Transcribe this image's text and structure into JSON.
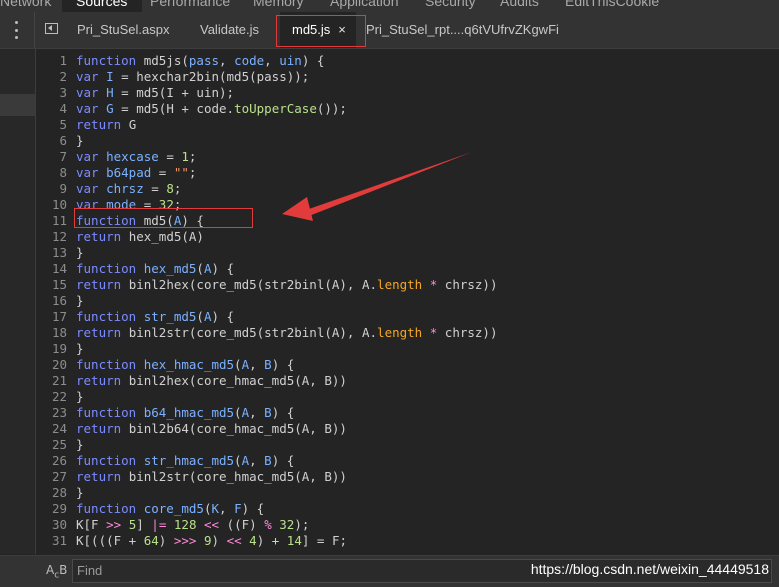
{
  "top_tabs": [
    "Network",
    "Sources",
    "Performance",
    "Memory",
    "Application",
    "Security",
    "Audits",
    "EditThisCookie"
  ],
  "file_tabs": [
    {
      "label": "Pri_StuSel.aspx"
    },
    {
      "label": "Validate.js"
    },
    {
      "label": "md5.js",
      "close": "×"
    },
    {
      "label": "Pri_StuSel_rpt....q6tVUfrvZKgwFi"
    }
  ],
  "icons": {
    "more": "kebab-icon",
    "navigator": "toggle-navigator-icon",
    "close": "close-icon",
    "match_case": "match-case-icon"
  },
  "colors": {
    "keyword": "#7b8cff",
    "variable": "#7bb1ff",
    "number": "#b9e08a",
    "string": "#f29766",
    "annotation": "#e23b3b"
  },
  "code_lines": [
    {
      "n": "1",
      "t": [
        [
          "k",
          "function "
        ],
        [
          "p",
          "md5js("
        ],
        [
          "v",
          "pass"
        ],
        [
          "p",
          ", "
        ],
        [
          "v",
          "code"
        ],
        [
          "p",
          ", "
        ],
        [
          "v",
          "uin"
        ],
        [
          "p",
          ") {"
        ]
      ]
    },
    {
      "n": "2",
      "t": [
        [
          "k",
          "var "
        ],
        [
          "v",
          "I"
        ],
        [
          "p",
          " = hexchar2bin(md5(pass));"
        ]
      ]
    },
    {
      "n": "3",
      "t": [
        [
          "k",
          "var "
        ],
        [
          "v",
          "H"
        ],
        [
          "p",
          " = md5(I + uin);"
        ]
      ]
    },
    {
      "n": "4",
      "t": [
        [
          "k",
          "var "
        ],
        [
          "v",
          "G"
        ],
        [
          "p",
          " = md5(H + code."
        ],
        [
          "n",
          "toUpperCase"
        ],
        [
          "p",
          "());"
        ]
      ]
    },
    {
      "n": "5",
      "t": [
        [
          "k",
          "return "
        ],
        [
          "p",
          "G"
        ]
      ]
    },
    {
      "n": "6",
      "t": [
        [
          "p",
          "}"
        ]
      ]
    },
    {
      "n": "7",
      "t": [
        [
          "k",
          "var "
        ],
        [
          "v",
          "hexcase"
        ],
        [
          "p",
          " = "
        ],
        [
          "n",
          "1"
        ],
        [
          "p",
          ";"
        ]
      ]
    },
    {
      "n": "8",
      "t": [
        [
          "k",
          "var "
        ],
        [
          "v",
          "b64pad"
        ],
        [
          "p",
          " = "
        ],
        [
          "s",
          "\"\""
        ],
        [
          "p",
          ";"
        ]
      ]
    },
    {
      "n": "9",
      "t": [
        [
          "k",
          "var "
        ],
        [
          "v",
          "chrsz"
        ],
        [
          "p",
          " = "
        ],
        [
          "n",
          "8"
        ],
        [
          "p",
          ";"
        ]
      ]
    },
    {
      "n": "10",
      "t": [
        [
          "k",
          "var "
        ],
        [
          "v",
          "mode"
        ],
        [
          "p",
          " = "
        ],
        [
          "n",
          "32"
        ],
        [
          "p",
          ";"
        ]
      ]
    },
    {
      "n": "11",
      "t": [
        [
          "k",
          "function "
        ],
        [
          "p",
          "md5("
        ],
        [
          "v",
          "A"
        ],
        [
          "p",
          ") {"
        ]
      ]
    },
    {
      "n": "12",
      "t": [
        [
          "k",
          "return "
        ],
        [
          "p",
          "hex_md5(A)"
        ]
      ]
    },
    {
      "n": "13",
      "t": [
        [
          "p",
          "}"
        ]
      ]
    },
    {
      "n": "14",
      "t": [
        [
          "k",
          "function "
        ],
        [
          "v",
          "hex_md5"
        ],
        [
          "p",
          "("
        ],
        [
          "v",
          "A"
        ],
        [
          "p",
          ") {"
        ]
      ]
    },
    {
      "n": "15",
      "t": [
        [
          "k",
          "return "
        ],
        [
          "p",
          "binl2hex(core_md5(str2binl(A), A."
        ],
        [
          "m",
          "length"
        ],
        [
          "p",
          " "
        ],
        [
          "o",
          "*"
        ],
        [
          "p",
          " chrsz))"
        ]
      ]
    },
    {
      "n": "16",
      "t": [
        [
          "p",
          "}"
        ]
      ]
    },
    {
      "n": "17",
      "t": [
        [
          "k",
          "function "
        ],
        [
          "v",
          "str_md5"
        ],
        [
          "p",
          "("
        ],
        [
          "v",
          "A"
        ],
        [
          "p",
          ") {"
        ]
      ]
    },
    {
      "n": "18",
      "t": [
        [
          "k",
          "return "
        ],
        [
          "p",
          "binl2str(core_md5(str2binl(A), A."
        ],
        [
          "m",
          "length"
        ],
        [
          "p",
          " "
        ],
        [
          "o",
          "*"
        ],
        [
          "p",
          " chrsz))"
        ]
      ]
    },
    {
      "n": "19",
      "t": [
        [
          "p",
          "}"
        ]
      ]
    },
    {
      "n": "20",
      "t": [
        [
          "k",
          "function "
        ],
        [
          "v",
          "hex_hmac_md5"
        ],
        [
          "p",
          "("
        ],
        [
          "v",
          "A"
        ],
        [
          "p",
          ", "
        ],
        [
          "v",
          "B"
        ],
        [
          "p",
          ") {"
        ]
      ]
    },
    {
      "n": "21",
      "t": [
        [
          "k",
          "return "
        ],
        [
          "p",
          "binl2hex(core_hmac_md5(A, B))"
        ]
      ]
    },
    {
      "n": "22",
      "t": [
        [
          "p",
          "}"
        ]
      ]
    },
    {
      "n": "23",
      "t": [
        [
          "k",
          "function "
        ],
        [
          "v",
          "b64_hmac_md5"
        ],
        [
          "p",
          "("
        ],
        [
          "v",
          "A"
        ],
        [
          "p",
          ", "
        ],
        [
          "v",
          "B"
        ],
        [
          "p",
          ") {"
        ]
      ]
    },
    {
      "n": "24",
      "t": [
        [
          "k",
          "return "
        ],
        [
          "p",
          "binl2b64(core_hmac_md5(A, B))"
        ]
      ]
    },
    {
      "n": "25",
      "t": [
        [
          "p",
          "}"
        ]
      ]
    },
    {
      "n": "26",
      "t": [
        [
          "k",
          "function "
        ],
        [
          "v",
          "str_hmac_md5"
        ],
        [
          "p",
          "("
        ],
        [
          "v",
          "A"
        ],
        [
          "p",
          ", "
        ],
        [
          "v",
          "B"
        ],
        [
          "p",
          ") {"
        ]
      ]
    },
    {
      "n": "27",
      "t": [
        [
          "k",
          "return "
        ],
        [
          "p",
          "binl2str(core_hmac_md5(A, B))"
        ]
      ]
    },
    {
      "n": "28",
      "t": [
        [
          "p",
          "}"
        ]
      ]
    },
    {
      "n": "29",
      "t": [
        [
          "k",
          "function "
        ],
        [
          "v",
          "core_md5"
        ],
        [
          "p",
          "("
        ],
        [
          "v",
          "K"
        ],
        [
          "p",
          ", "
        ],
        [
          "v",
          "F"
        ],
        [
          "p",
          ") {"
        ]
      ]
    },
    {
      "n": "30",
      "t": [
        [
          "p",
          "K[F "
        ],
        [
          "o",
          ">>"
        ],
        [
          "p",
          " "
        ],
        [
          "n",
          "5"
        ],
        [
          "p",
          "] "
        ],
        [
          "o",
          "|="
        ],
        [
          "p",
          " "
        ],
        [
          "n",
          "128"
        ],
        [
          "p",
          " "
        ],
        [
          "o",
          "<<"
        ],
        [
          "p",
          " ((F) "
        ],
        [
          "o",
          "%"
        ],
        [
          "p",
          " "
        ],
        [
          "n",
          "32"
        ],
        [
          "p",
          ");"
        ]
      ]
    },
    {
      "n": "31",
      "t": [
        [
          "p",
          "K[(((F + "
        ],
        [
          "n",
          "64"
        ],
        [
          "p",
          ") "
        ],
        [
          "o",
          ">>>"
        ],
        [
          "p",
          " "
        ],
        [
          "n",
          "9"
        ],
        [
          "p",
          ") "
        ],
        [
          "o",
          "<<"
        ],
        [
          "p",
          " "
        ],
        [
          "n",
          "4"
        ],
        [
          "p",
          ") + "
        ],
        [
          "n",
          "14"
        ],
        [
          "p",
          "] = F;"
        ]
      ]
    }
  ],
  "find": {
    "placeholder": "Find"
  },
  "watermark": "https://blog.csdn.net/weixin_44449518"
}
